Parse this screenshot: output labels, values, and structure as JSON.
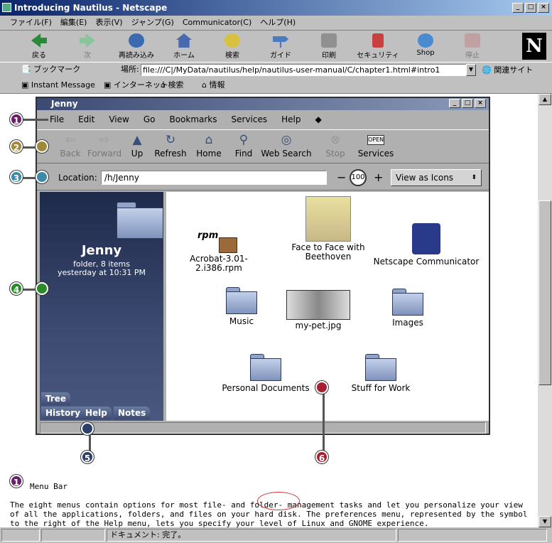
{
  "browser": {
    "title": "Introducing Nautilus - Netscape",
    "menus": [
      "ファイル(F)",
      "編集(E)",
      "表示(V)",
      "ジャンプ(G)",
      "Communicator(C)",
      "ヘルプ(H)"
    ],
    "nav_buttons": [
      "戻る",
      "次",
      "再読み込み",
      "ホーム",
      "検索",
      "ガイド",
      "印刷",
      "セキュリティ",
      "Shop",
      "停止"
    ],
    "logo": "N",
    "bookmarks_label": "ブックマーク",
    "location_label": "場所:",
    "url": "file:///C|/MyData/nautilus/help/nautilus-user-manual/C/chapter1.html#intro1",
    "related_label": "関連サイト",
    "personal": [
      "Instant Message",
      "インターネット",
      "検索",
      "情報"
    ],
    "status": "ドキュメント: 完了。"
  },
  "nautilus": {
    "title": "Jenny",
    "menus": [
      "File",
      "Edit",
      "View",
      "Go",
      "Bookmarks",
      "Services",
      "Help"
    ],
    "toolbar": [
      "Back",
      "Forward",
      "Up",
      "Refresh",
      "Home",
      "Find",
      "Web Search",
      "Stop",
      "Services"
    ],
    "location_label": "Location:",
    "location": "/h/Jenny",
    "zoom": "100",
    "view_as": "View as Icons",
    "sidebar": {
      "name": "Jenny",
      "info1": "folder, 8 items",
      "info2": "yesterday at 10:31 PM",
      "tabs": [
        "Tree",
        "History",
        "Help",
        "Notes"
      ]
    },
    "items": [
      "Acrobat-3.01-2.i386.rpm",
      "Face to Face with Beethoven",
      "Netscape Communicator",
      "Music",
      "my-pet.jpg",
      "Images",
      "Personal Documents",
      "Stuff for Work"
    ],
    "rpm_label": "rpm",
    "open_label": "OPEN"
  },
  "callouts": [
    "1",
    "2",
    "3",
    "4",
    "5",
    "6"
  ],
  "description": {
    "number": "1",
    "title": "Menu Bar",
    "body": "The eight menus contain options for most file- and folder- management tasks and let you personalize your view of all the applications, folders, and files on your hard disk. The preferences menu, represented by the symbol to the right of the Help menu, lets you specify your level of Linux and GNOME experience."
  },
  "colors": {
    "callout1": "#6a1f6a",
    "callout2": "#a08a3a",
    "callout3": "#3c8aa8",
    "callout4": "#2a8a2a",
    "callout5": "#2c3f6a",
    "callout6": "#a82030"
  }
}
